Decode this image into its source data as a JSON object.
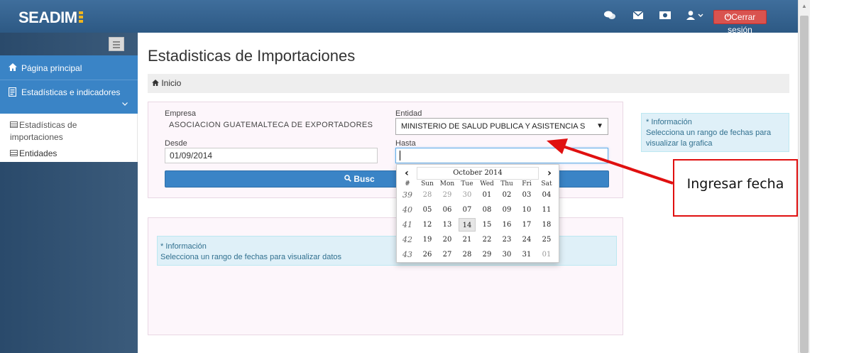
{
  "header": {
    "brand": "SEADIM",
    "icons": [
      "comments-icon",
      "envelope-icon",
      "money-icon",
      "user-icon"
    ],
    "logout_label": "Cerrar sesión",
    "logout_color": "#d9534f"
  },
  "sidebar": {
    "items": [
      {
        "label": "Página principal",
        "icon": "home-icon"
      },
      {
        "label": "Estadísticas e indicadores",
        "icon": "document-icon"
      }
    ],
    "subitems": [
      {
        "label": "Estadísticas de importaciones",
        "icon": "table-icon"
      },
      {
        "label": "Entidades",
        "icon": "table-icon"
      }
    ]
  },
  "main": {
    "title": "Estadisticas de Importaciones",
    "breadcrumb": "Inicio",
    "filters": {
      "empresa_label": "Empresa",
      "empresa_value": "ASOCIACION GUATEMALTECA DE EXPORTADORES",
      "entidad_label": "Entidad",
      "entidad_value": "MINISTERIO DE SALUD PUBLICA Y ASISTENCIA S",
      "desde_label": "Desde",
      "desde_value": "01/09/2014",
      "hasta_label": "Hasta",
      "hasta_value": "",
      "search_label": "Busc"
    },
    "info_side": {
      "title": "* Información",
      "text": "Selecciona un rango de fechas para visualizar la grafica"
    },
    "info_data": {
      "title": "* Información",
      "text": "Selecciona un rango de fechas para visualizar datos"
    }
  },
  "datepicker": {
    "title": "October 2014",
    "week_header": "#",
    "day_headers": [
      "Sun",
      "Mon",
      "Tue",
      "Wed",
      "Thu",
      "Fri",
      "Sat"
    ],
    "today": "14",
    "weeks": [
      {
        "week": "39",
        "days": [
          "28",
          "29",
          "30",
          "01",
          "02",
          "03",
          "04"
        ],
        "old": [
          0,
          1,
          2
        ]
      },
      {
        "week": "40",
        "days": [
          "05",
          "06",
          "07",
          "08",
          "09",
          "10",
          "11"
        ],
        "old": []
      },
      {
        "week": "41",
        "days": [
          "12",
          "13",
          "14",
          "15",
          "16",
          "17",
          "18"
        ],
        "old": []
      },
      {
        "week": "42",
        "days": [
          "19",
          "20",
          "21",
          "22",
          "23",
          "24",
          "25"
        ],
        "old": []
      },
      {
        "week": "43",
        "days": [
          "26",
          "27",
          "28",
          "29",
          "30",
          "31",
          "01"
        ],
        "old": [
          6
        ]
      }
    ]
  },
  "annotation": {
    "text": "Ingresar fecha",
    "color": "#e01010"
  }
}
